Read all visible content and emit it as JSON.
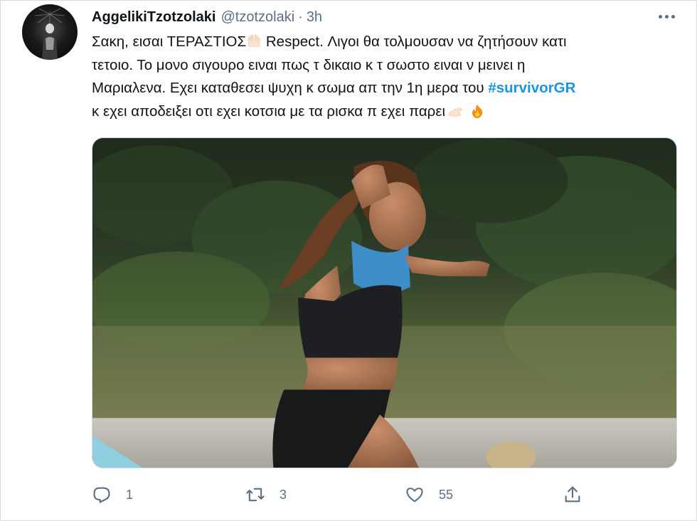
{
  "user": {
    "display_name": "AggelikiTzotzolaki",
    "handle": "@tzotzolaki",
    "separator": "·",
    "time": "3h"
  },
  "tweet": {
    "line1_a": "Σακη, εισαι ΤΕΡΑΣΤΙΟΣ",
    "line1_b": " Respect. Λιγοι θα τολμουσαν να ζητήσουν κατι",
    "line2": "τετοιο. Το μονο σιγουρο ειναι πως τ δικαιο κ τ σωστο ειναι ν μεινει η",
    "line3_a": "Μαριαλενα. Εχει καταθεσει ψυχη κ σωμα απ την 1η μερα του ",
    "hashtag": "#survivorGR",
    "line4": "κ εχει αποδειξει οτι εχει κοτσια με τα ρισκα π εχει παρει",
    "emojis": [
      "raising-hands-icon",
      "flexed-biceps-icon",
      "fire-icon"
    ]
  },
  "media": {
    "subject": "photo"
  },
  "actions": {
    "reply_count": "1",
    "retweet_count": "3",
    "like_count": "55",
    "icons": [
      "reply-icon",
      "retweet-icon",
      "like-icon",
      "share-icon"
    ]
  },
  "colors": {
    "hashtag": "#1b95e0",
    "muted": "#5b7083",
    "text": "#0f1419"
  }
}
